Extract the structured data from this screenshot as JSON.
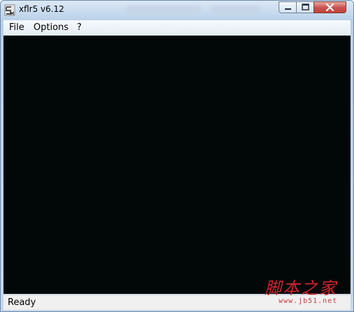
{
  "window": {
    "title": "xflr5 v6.12",
    "icons": {
      "app": "xflr5-app-icon",
      "minimize": "minimize-icon",
      "maximize": "maximize-icon",
      "close": "close-icon"
    }
  },
  "menubar": {
    "items": [
      {
        "label": "File"
      },
      {
        "label": "Options"
      },
      {
        "label": "?"
      }
    ]
  },
  "canvas": {
    "background": "#020707"
  },
  "statusbar": {
    "text": "Ready"
  },
  "watermark": {
    "title": "脚本之家",
    "url": "www.jb51.net",
    "color": "#d2262f"
  }
}
